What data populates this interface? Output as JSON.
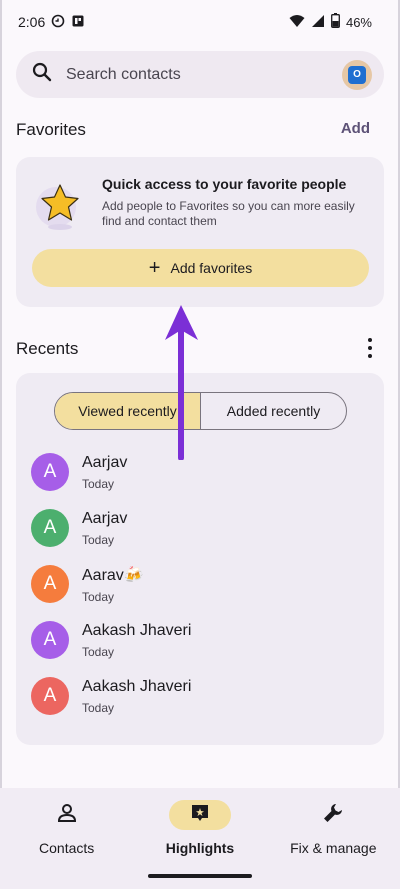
{
  "status_bar": {
    "time": "2:06",
    "battery": "46%"
  },
  "search": {
    "placeholder": "Search contacts",
    "account_badge": "O"
  },
  "favorites": {
    "title": "Favorites",
    "add_label": "Add",
    "card_title": "Quick access to your favorite people",
    "card_description": "Add people to Favorites so you can more easily find and contact them",
    "add_button_label": "Add favorites"
  },
  "recents": {
    "title": "Recents",
    "tabs": [
      {
        "label": "Viewed recently",
        "selected": true
      },
      {
        "label": "Added recently",
        "selected": false
      }
    ],
    "contacts": [
      {
        "initial": "A",
        "name": "Aarjav",
        "time": "Today",
        "color": "#a65ee8"
      },
      {
        "initial": "A",
        "name": "Aarjav",
        "time": "Today",
        "color": "#4caf6e"
      },
      {
        "initial": "A",
        "name": "Aarav🍻",
        "time": "Today",
        "color": "#f57c3d"
      },
      {
        "initial": "A",
        "name": "Aakash Jhaveri",
        "time": "Today",
        "color": "#a65ee8"
      },
      {
        "initial": "A",
        "name": "Aakash Jhaveri",
        "time": "Today",
        "color": "#ec6660"
      }
    ]
  },
  "bottom_nav": {
    "items": [
      {
        "label": "Contacts",
        "icon": "person-icon",
        "active": false
      },
      {
        "label": "Highlights",
        "icon": "highlights-icon",
        "active": true
      },
      {
        "label": "Fix & manage",
        "icon": "wrench-icon",
        "active": false
      }
    ]
  },
  "colors": {
    "accent": "#f3df9f",
    "arrow": "#7b2fd6",
    "surface": "#efebf3"
  }
}
